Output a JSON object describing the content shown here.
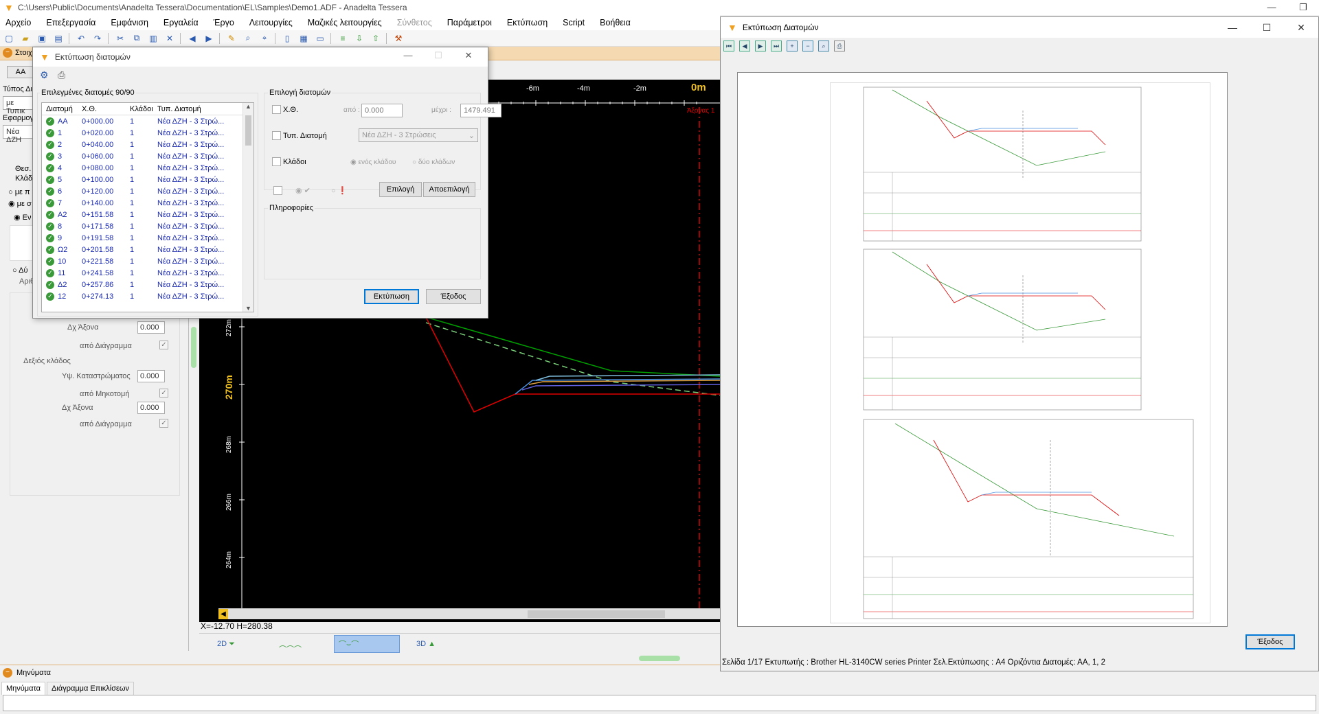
{
  "window": {
    "title": "C:\\Users\\Public\\Documents\\Anadelta Tessera\\Documentation\\EL\\Samples\\Demo1.ADF - Anadelta Tessera"
  },
  "menu": [
    "Αρχείο",
    "Επεξεργασία",
    "Εμφάνιση",
    "Εργαλεία",
    "Έργο",
    "Λειτουργίες",
    "Μαζικές λειτουργίες",
    "Σύνθετος",
    "Παράμετροι",
    "Εκτύπωση",
    "Script",
    "Βοήθεια"
  ],
  "left_panel": {
    "header": "Στοιχ",
    "type_label": "Τύπος Δια",
    "type_value": "με Τυπικ",
    "apply_label": "Εφαρμογ",
    "apply_value": "Νέα ΔΖΗ",
    "pos_label": "Θεσ.",
    "branches_label": "Κλάδ",
    "radio1": "με π",
    "radio2": "με σ",
    "radio3": "Εν",
    "radio4": "Δύ",
    "arith": "Αριθ",
    "dx_axis_label": "Δχ Άξονα",
    "dx_axis_value": "0.000",
    "from_diagram": "από Διάγραμμα",
    "right_branch": "Δεξιός κλάδος",
    "restore_height_label": "Υψ. Καταστρώματος",
    "restore_height_value": "0.000",
    "from_profile": "από Μηκοτομή",
    "dx_axis2_label": "Δχ Άξονα",
    "dx_axis2_value": "0.000",
    "from_diagram2": "από Διάγραμμα"
  },
  "canvas": {
    "ruler_labels": [
      "-6m",
      "-4m",
      "-2m",
      "0m"
    ],
    "axis_label": "Άξονας 1",
    "vertical_labels": [
      "272m",
      "270m",
      "268m",
      "266m",
      "264m"
    ],
    "coords": "X=-12.70  H=280.38"
  },
  "view_tabs": [
    "2D",
    "",
    "",
    "3D"
  ],
  "dialog": {
    "title": "Εκτύπωση διατομών",
    "selected_label": "Επιλεγμένες διατομές 90/90",
    "columns": [
      "Διατομή",
      "Χ.Θ.",
      "Κλάδοι",
      "Τυπ. Διατομή"
    ],
    "rows": [
      [
        "ΑΑ",
        "0+000.00",
        "1",
        "Νέα ΔΖΗ - 3 Στρώ..."
      ],
      [
        "1",
        "0+020.00",
        "1",
        "Νέα ΔΖΗ - 3 Στρώ..."
      ],
      [
        "2",
        "0+040.00",
        "1",
        "Νέα ΔΖΗ - 3 Στρώ..."
      ],
      [
        "3",
        "0+060.00",
        "1",
        "Νέα ΔΖΗ - 3 Στρώ..."
      ],
      [
        "4",
        "0+080.00",
        "1",
        "Νέα ΔΖΗ - 3 Στρώ..."
      ],
      [
        "5",
        "0+100.00",
        "1",
        "Νέα ΔΖΗ - 3 Στρώ..."
      ],
      [
        "6",
        "0+120.00",
        "1",
        "Νέα ΔΖΗ - 3 Στρώ..."
      ],
      [
        "7",
        "0+140.00",
        "1",
        "Νέα ΔΖΗ - 3 Στρώ..."
      ],
      [
        "Α2",
        "0+151.58",
        "1",
        "Νέα ΔΖΗ - 3 Στρώ..."
      ],
      [
        "8",
        "0+171.58",
        "1",
        "Νέα ΔΖΗ - 3 Στρώ..."
      ],
      [
        "9",
        "0+191.58",
        "1",
        "Νέα ΔΖΗ - 3 Στρώ..."
      ],
      [
        "Ω2",
        "0+201.58",
        "1",
        "Νέα ΔΖΗ - 3 Στρώ..."
      ],
      [
        "10",
        "0+221.58",
        "1",
        "Νέα ΔΖΗ - 3 Στρώ..."
      ],
      [
        "11",
        "0+241.58",
        "1",
        "Νέα ΔΖΗ - 3 Στρώ..."
      ],
      [
        "Δ2",
        "0+257.86",
        "1",
        "Νέα ΔΖΗ - 3 Στρώ..."
      ],
      [
        "12",
        "0+274.13",
        "1",
        "Νέα ΔΖΗ - 3 Στρώ..."
      ]
    ],
    "selection_group": "Επιλογή διατομών",
    "chk_xth": "Χ.Θ.",
    "from_label": "από :",
    "from_value": "0.000",
    "to_label": "μέχρι :",
    "to_value": "1479.491",
    "chk_typ": "Τυπ. Διατομή",
    "typ_value": "Νέα ΔΖΗ - 3 Στρώσεις",
    "chk_branches": "Κλάδοι",
    "one_branch": "ενός κλάδου",
    "two_branches": "δύο κλάδων",
    "select_btn": "Επιλογή",
    "deselect_btn": "Αποεπιλογή",
    "info_group": "Πληροφορίες",
    "print_btn": "Εκτύπωση",
    "exit_btn": "Έξοδος"
  },
  "preview": {
    "title": "Εκτύπωση Διατομών",
    "exit_btn": "Έξοδος",
    "status": "Σελίδα 1/17 Εκτυπωτής : Brother HL-3140CW series Printer Σελ.Εκτύπωσης : A4 Οριζόντια Διατομές:  ΑΑ, 1, 2"
  },
  "messages": {
    "header": "Μηνύματα",
    "tabs": [
      "Μηνύματα",
      "Διάγραμμα Επικλίσεων"
    ]
  },
  "colors": {
    "accent": "#0078d7",
    "brand": "#f0a020",
    "canvas_bg": "#000000",
    "ground": "#00a000",
    "design": "#e00000",
    "label": "#f0c020"
  }
}
